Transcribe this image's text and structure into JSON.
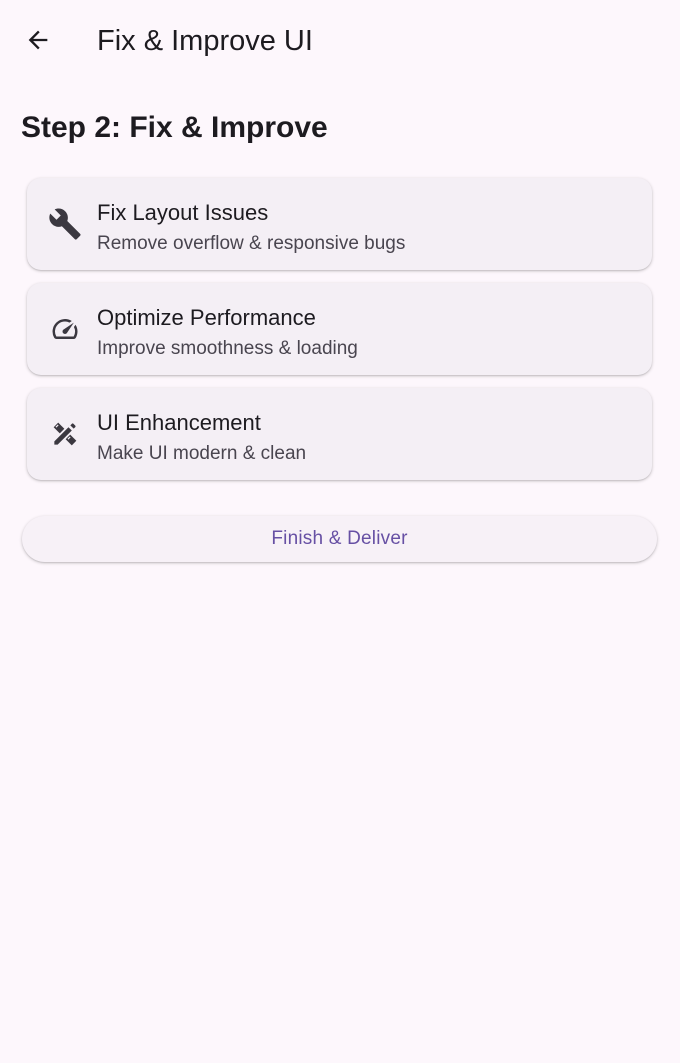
{
  "app_bar": {
    "back_icon": "arrow-back-icon",
    "title": "Fix & Improve UI"
  },
  "step_title": "Step 2: Fix & Improve",
  "tasks": [
    {
      "icon": "wrench-icon",
      "title": "Fix Layout Issues",
      "subtitle": "Remove overflow & responsive bugs"
    },
    {
      "icon": "speed-gauge-icon",
      "title": "Optimize Performance",
      "subtitle": "Improve smoothness & loading"
    },
    {
      "icon": "design-tools-icon",
      "title": "UI Enhancement",
      "subtitle": "Make UI modern & clean"
    }
  ],
  "finish_button": {
    "label": "Finish & Deliver"
  },
  "colors": {
    "background": "#fdf7fc",
    "card": "#f4eff5",
    "primary": "#6750a4",
    "text": "#1d1b20",
    "secondary_text": "#49454f"
  }
}
